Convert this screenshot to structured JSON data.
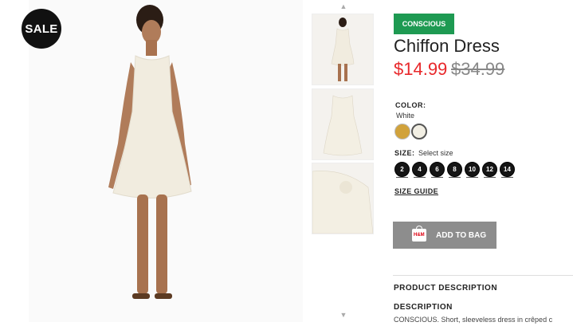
{
  "badge": {
    "sale": "SALE",
    "conscious": "CONSCIOUS"
  },
  "product": {
    "title": "Chiffon Dress",
    "price_sale": "$14.99",
    "price_original": "$34.99"
  },
  "color": {
    "label": "COLOR:",
    "value": "White",
    "swatches": [
      "#d1a23b",
      "#f2efe4"
    ]
  },
  "size": {
    "label": "SIZE:",
    "hint": "Select size",
    "options": [
      "2",
      "4",
      "6",
      "8",
      "10",
      "12",
      "14"
    ]
  },
  "links": {
    "size_guide": "SIZE GUIDE"
  },
  "cart": {
    "add_label": "ADD TO BAG",
    "bag_logo": "H&M"
  },
  "description": {
    "heading": "PRODUCT DESCRIPTION",
    "subheading": "DESCRIPTION",
    "text": "CONSCIOUS. Short, sleeveless dress in crêped c"
  },
  "icons": {
    "thumb_up": "chevron-up-icon",
    "thumb_down": "chevron-down-icon",
    "bag": "shopping-bag-icon"
  }
}
